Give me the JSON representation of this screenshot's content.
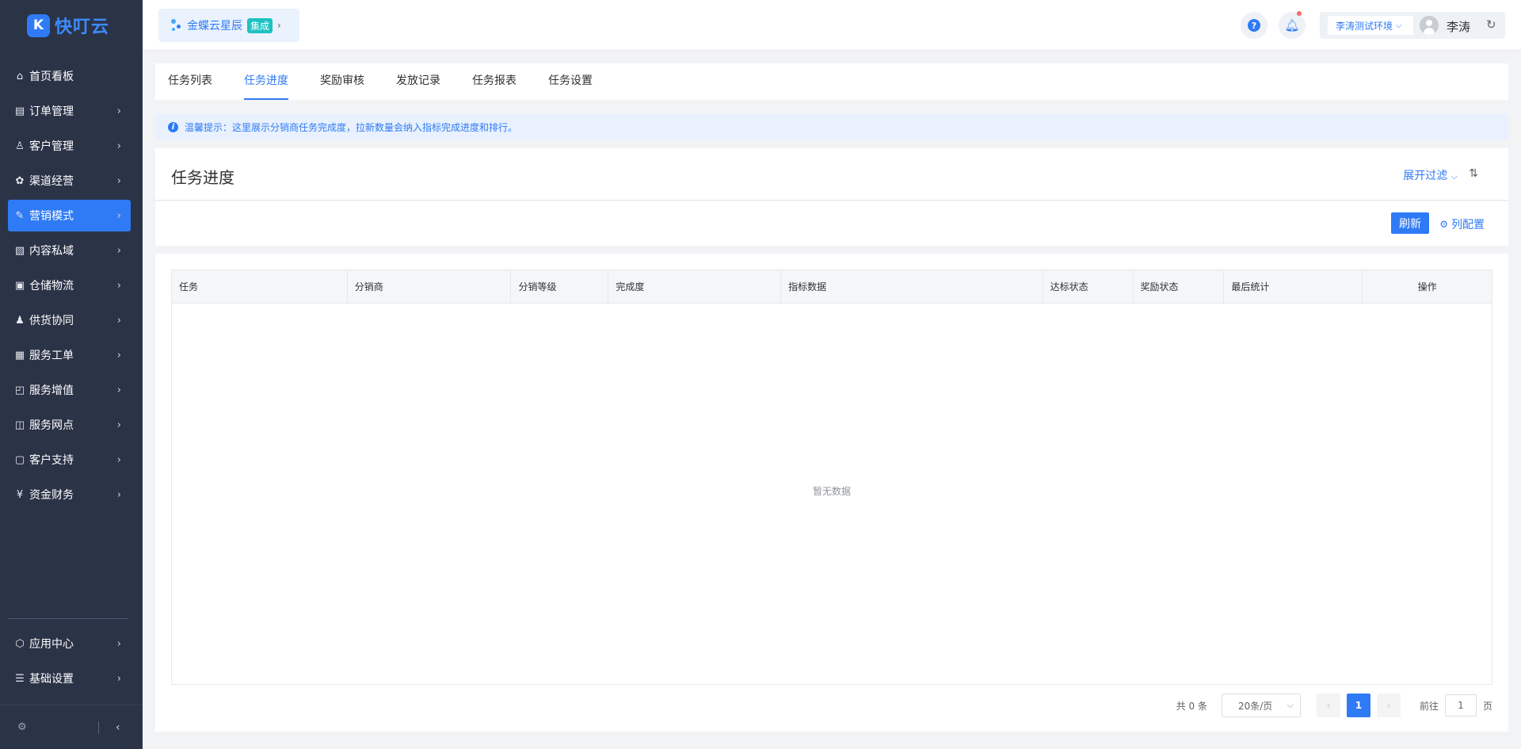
{
  "brand": {
    "mark": "K",
    "name": "快叮云"
  },
  "sidebar": {
    "items": [
      {
        "label": "首页看板",
        "icon": "home-icon",
        "glyph": "⌂",
        "chevron": false
      },
      {
        "label": "订单管理",
        "icon": "order-icon",
        "glyph": "▤",
        "chevron": true
      },
      {
        "label": "客户管理",
        "icon": "customer-icon",
        "glyph": "♙",
        "chevron": true
      },
      {
        "label": "渠道经营",
        "icon": "channel-icon",
        "glyph": "✿",
        "chevron": true
      },
      {
        "label": "营销模式",
        "icon": "marketing-icon",
        "glyph": "✎",
        "chevron": true,
        "active": true
      },
      {
        "label": "内容私域",
        "icon": "content-icon",
        "glyph": "▧",
        "chevron": true
      },
      {
        "label": "仓储物流",
        "icon": "warehouse-icon",
        "glyph": "▣",
        "chevron": true
      },
      {
        "label": "供货协同",
        "icon": "supply-icon",
        "glyph": "♟",
        "chevron": true
      },
      {
        "label": "服务工单",
        "icon": "ticket-icon",
        "glyph": "▦",
        "chevron": true
      },
      {
        "label": "服务增值",
        "icon": "value-added-icon",
        "glyph": "◰",
        "chevron": true
      },
      {
        "label": "服务网点",
        "icon": "store-icon",
        "glyph": "◫",
        "chevron": true
      },
      {
        "label": "客户支持",
        "icon": "support-icon",
        "glyph": "▢",
        "chevron": true
      },
      {
        "label": "资金财务",
        "icon": "finance-icon",
        "glyph": "¥",
        "chevron": true
      }
    ],
    "bottom_items": [
      {
        "label": "应用中心",
        "icon": "app-center-icon",
        "glyph": "⬡",
        "chevron": true
      },
      {
        "label": "基础设置",
        "icon": "settings-icon",
        "glyph": "☰",
        "chevron": true
      }
    ]
  },
  "topbar": {
    "tenant_name": "金蝶云星辰",
    "tenant_tag": "集成",
    "env": "李涛测试环境",
    "user": "李涛"
  },
  "tabs": [
    {
      "label": "任务列表"
    },
    {
      "label": "任务进度",
      "active": true
    },
    {
      "label": "奖励审核"
    },
    {
      "label": "发放记录"
    },
    {
      "label": "任务报表"
    },
    {
      "label": "任务设置"
    }
  ],
  "notice": "温馨提示：这里展示分销商任务完成度，拉新数量会纳入指标完成进度和排行。",
  "panel": {
    "title": "任务进度",
    "filter_toggle": "展开过滤",
    "refresh": "刷新",
    "col_config": "列配置"
  },
  "table": {
    "columns": [
      {
        "label": "任务"
      },
      {
        "label": "分销商"
      },
      {
        "label": "分销等级"
      },
      {
        "label": "完成度"
      },
      {
        "label": "指标数据"
      },
      {
        "label": "达标状态"
      },
      {
        "label": "奖励状态"
      },
      {
        "label": "最后统计"
      },
      {
        "label": "操作"
      }
    ],
    "empty_text": "暂无数据"
  },
  "pager": {
    "total": "共 0 条",
    "page_size": "20条/页",
    "current": "1",
    "goto_prefix": "前往",
    "goto_value": "1",
    "goto_suffix": "页"
  }
}
